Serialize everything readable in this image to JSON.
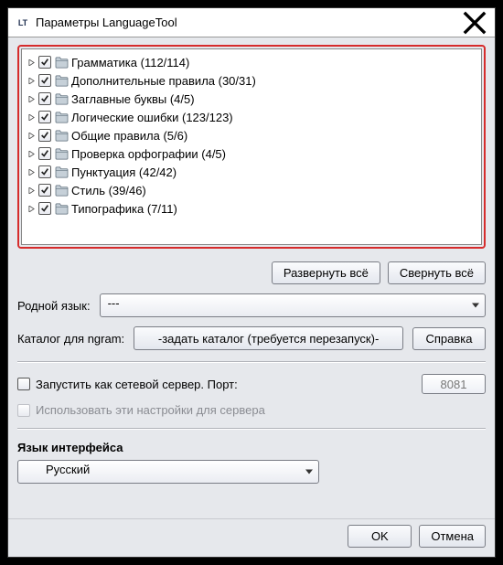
{
  "window": {
    "title": "Параметры LanguageTool",
    "app_icon_label": "LT"
  },
  "tree": [
    {
      "label": "Грамматика (112/114)",
      "checked": true
    },
    {
      "label": "Дополнительные правила (30/31)",
      "checked": true
    },
    {
      "label": "Заглавные буквы (4/5)",
      "checked": true
    },
    {
      "label": "Логические ошибки (123/123)",
      "checked": true
    },
    {
      "label": "Общие правила (5/6)",
      "checked": true
    },
    {
      "label": "Проверка орфографии (4/5)",
      "checked": true
    },
    {
      "label": "Пунктуация (42/42)",
      "checked": true
    },
    {
      "label": "Стиль (39/46)",
      "checked": true
    },
    {
      "label": "Типографика (7/11)",
      "checked": true
    }
  ],
  "buttons": {
    "expand_all": "Развернуть всё",
    "collapse_all": "Свернуть всё",
    "help": "Справка",
    "ok": "OK",
    "cancel": "Отмена"
  },
  "labels": {
    "native_lang": "Родной язык:",
    "ngram_dir": "Каталог для ngram:",
    "ngram_btn": "-задать каталог (требуется перезапуск)-",
    "run_server": "Запустить как сетевой сервер. Порт:",
    "use_server_settings": "Использовать эти настройки для сервера",
    "ui_lang": "Язык интерфейса"
  },
  "values": {
    "native_lang_selected": "---",
    "port": "8081",
    "ui_lang_selected": "Русский"
  },
  "state": {
    "run_server_checked": false,
    "use_server_settings_enabled": false
  }
}
